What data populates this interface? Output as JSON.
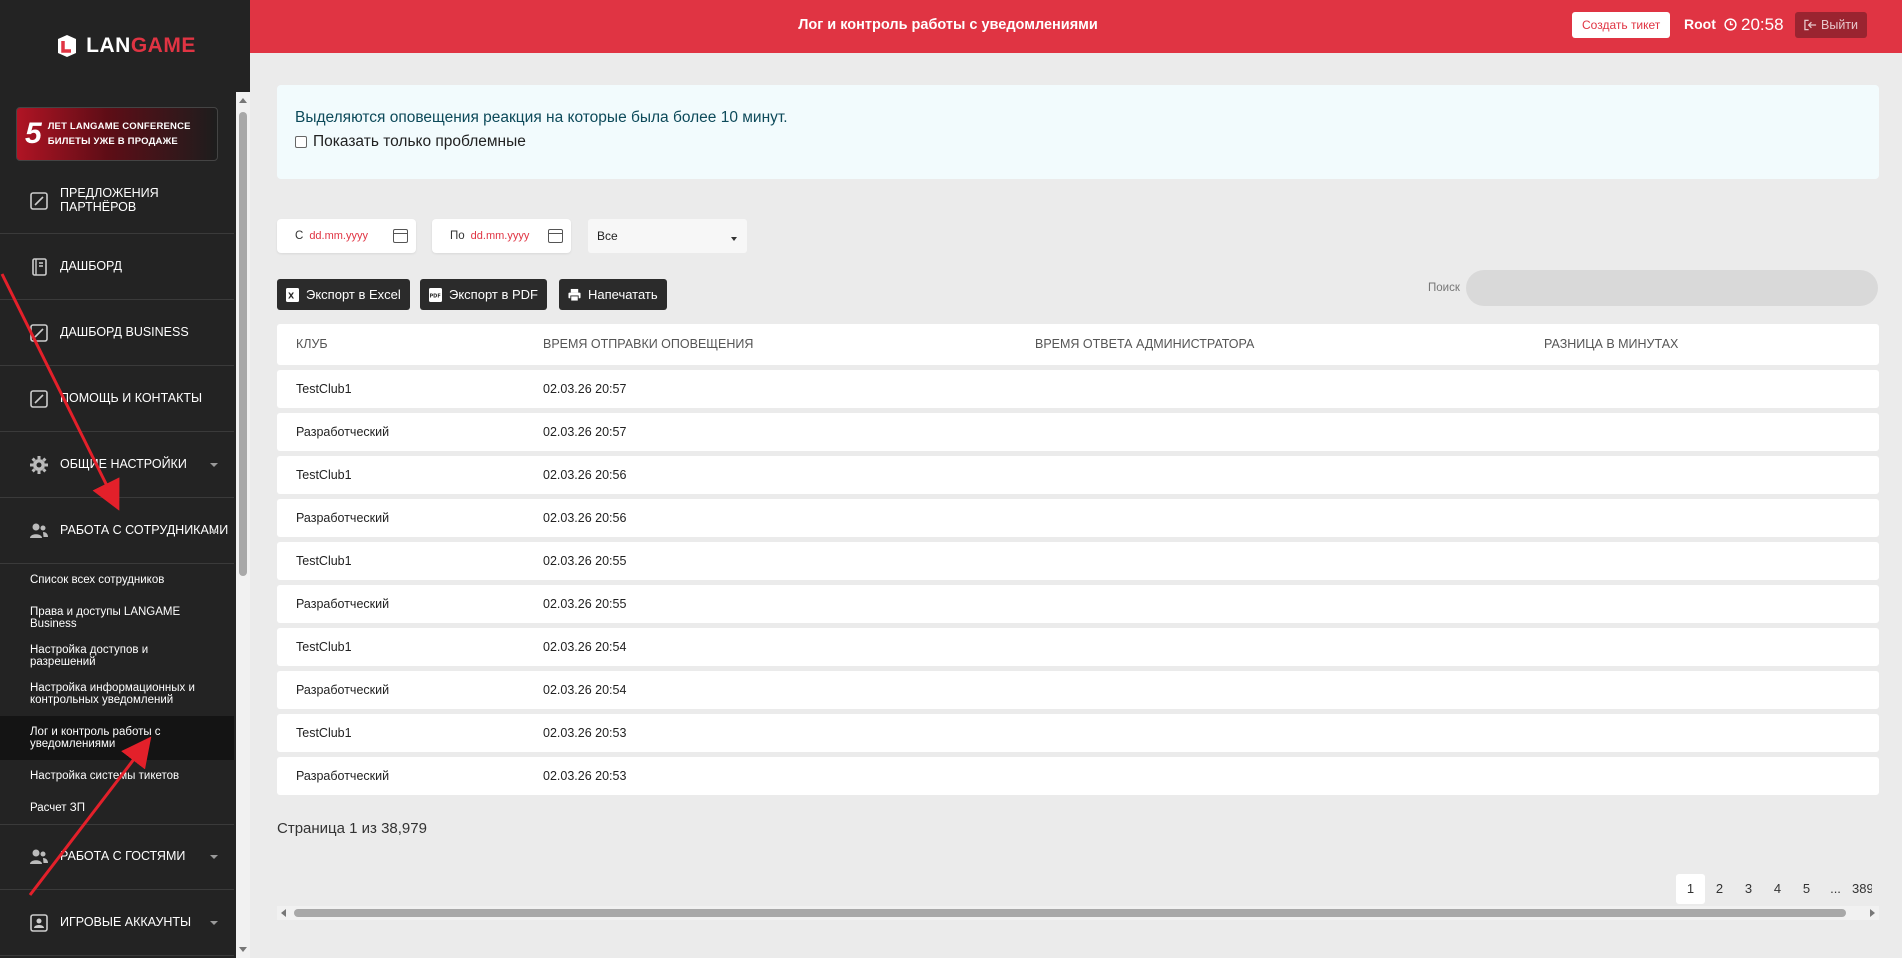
{
  "brand": {
    "logo_text_left": "LAN",
    "logo_text_right": "GAME",
    "accent": "#e03443"
  },
  "promo": {
    "number": "5",
    "line1": "ЛЕТ LANGAME CONFERENCE",
    "line2": "БИЛЕТЫ УЖЕ В ПРОДАЖЕ"
  },
  "sidebar": {
    "items": [
      {
        "label": "ПРЕДЛОЖЕНИЯ ПАРТНЁРОВ",
        "icon": "edit-square-icon"
      },
      {
        "label": "ДАШБОРД",
        "icon": "notebook-icon"
      },
      {
        "label": "ДАШБОРД BUSINESS",
        "icon": "edit-square-icon"
      },
      {
        "label": "ПОМОЩЬ И КОНТАКТЫ",
        "icon": "edit-square-icon"
      },
      {
        "label": "ОБЩИЕ НАСТРОЙКИ",
        "icon": "gear-icon"
      },
      {
        "label": "РАБОТА С СОТРУДНИКАМИ",
        "icon": "users-icon"
      }
    ],
    "subitems": [
      "Список всех сотрудников",
      "Права и доступы LANGAME Business",
      "Настройка доступов и разрешений",
      "Настройка информационных и контрольных уведомлений",
      "Лог и контроль работы с уведомлениями",
      "Настройка системы тикетов",
      "Расчет ЗП"
    ],
    "bottom_items": [
      {
        "label": "РАБОТА С ГОСТЯМИ",
        "icon": "users-icon"
      },
      {
        "label": "ИГРОВЫЕ АККАУНТЫ",
        "icon": "account-card-icon"
      }
    ]
  },
  "header": {
    "title": "Лог и контроль работы с уведомлениями",
    "ticket_button": "Создать тикет",
    "user": "Root",
    "time": "20:58",
    "logout": "Выйти"
  },
  "alert": {
    "message": "Выделяются оповещения реакция на которые была более 10 минут.",
    "checkbox_label": "Показать только проблемные"
  },
  "filters": {
    "from_label": "С",
    "to_label": "По",
    "date_placeholder": "dd.mm.yyyy",
    "select_value": "Все"
  },
  "toolbar": {
    "export_excel": "Экспорт в Excel",
    "export_pdf": "Экспорт в PDF",
    "print": "Напечатать",
    "search_label": "Поиск"
  },
  "table": {
    "headers": [
      "Клуб",
      "Время отправки оповещения",
      "Время ответа администратора",
      "Разница в минутах"
    ],
    "rows": [
      [
        "TestClub1",
        "02.03.26 20:57",
        "",
        ""
      ],
      [
        "Разработческий",
        "02.03.26 20:57",
        "",
        ""
      ],
      [
        "TestClub1",
        "02.03.26 20:56",
        "",
        ""
      ],
      [
        "Разработческий",
        "02.03.26 20:56",
        "",
        ""
      ],
      [
        "TestClub1",
        "02.03.26 20:55",
        "",
        ""
      ],
      [
        "Разработческий",
        "02.03.26 20:55",
        "",
        ""
      ],
      [
        "TestClub1",
        "02.03.26 20:54",
        "",
        ""
      ],
      [
        "Разработческий",
        "02.03.26 20:54",
        "",
        ""
      ],
      [
        "TestClub1",
        "02.03.26 20:53",
        "",
        ""
      ],
      [
        "Разработческий",
        "02.03.26 20:53",
        "",
        ""
      ]
    ]
  },
  "pagination": {
    "info": "Страница 1 из 38,979",
    "pages": [
      "1",
      "2",
      "3",
      "4",
      "5",
      "...",
      "389"
    ],
    "active": "1"
  }
}
